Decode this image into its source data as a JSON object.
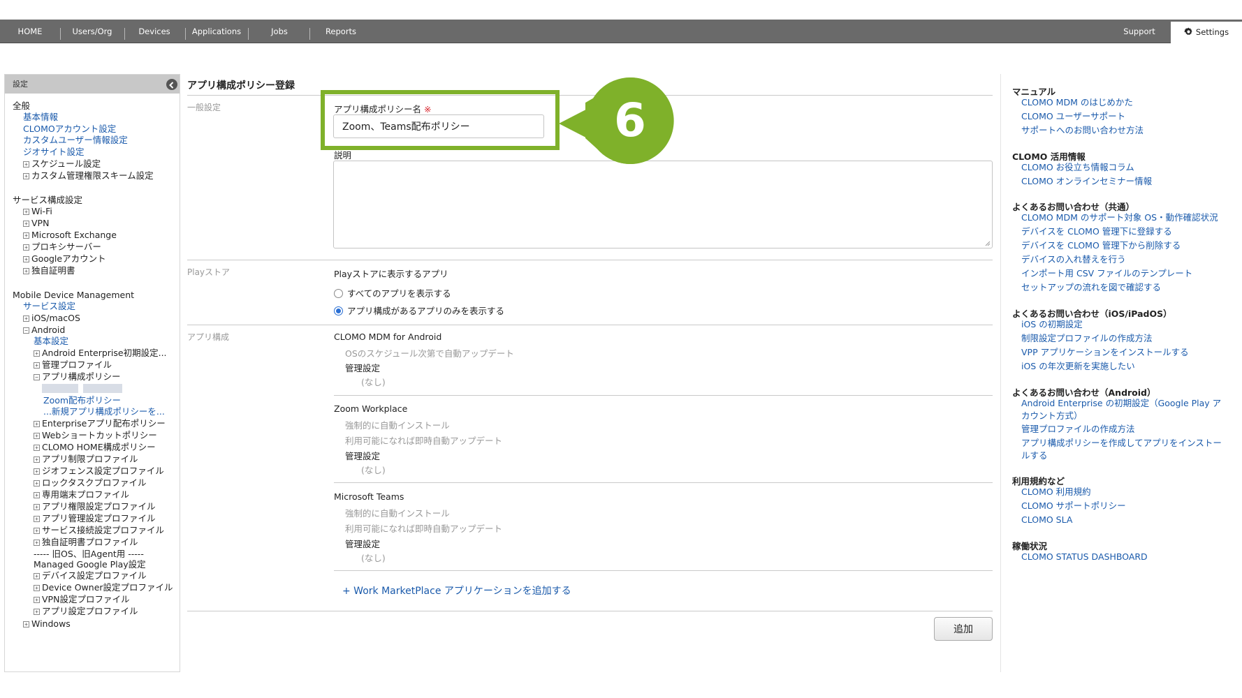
{
  "nav": {
    "items": [
      "HOME",
      "Users/Org",
      "Devices",
      "Applications",
      "Jobs",
      "Reports"
    ],
    "support": "Support",
    "settings": "Settings"
  },
  "sidebar": {
    "header": "設定",
    "general": "全般",
    "general_items": [
      "基本情報",
      "CLOMOアカウント設定",
      "カスタムユーザー情報設定",
      "ジオサイト設定"
    ],
    "general_expand": [
      "スケジュール設定",
      "カスタム管理権限スキーム設定"
    ],
    "service": "サービス構成設定",
    "service_items": [
      "Wi-Fi",
      "VPN",
      "Microsoft Exchange",
      "プロキシサーバー",
      "Googleアカウント",
      "独自証明書"
    ],
    "mdm": "Mobile Device Management",
    "mdm_service": "サービス設定",
    "ios": "iOS/macOS",
    "android": "Android",
    "android_basic": "基本設定",
    "android_items_1": [
      "Android Enterprise初期設定...",
      "管理プロファイル",
      "アプリ構成ポリシー"
    ],
    "policy_zoom": "Zoom配布ポリシー",
    "policy_new": "...新規アプリ構成ポリシーを...",
    "android_items_2": [
      "Enterpriseアプリ配布ポリシー",
      "Webショートカットポリシー",
      "CLOMO HOME構成ポリシー",
      "アプリ制限プロファイル",
      "ジオフェンス設定プロファイル",
      "ロックタスクプロファイル",
      "専用端末プロファイル",
      "アプリ権限設定プロファイル",
      "アプリ管理設定プロファイル",
      "サービス接続設定プロファイル",
      "独自証明書プロファイル"
    ],
    "legacy": "----- 旧OS、旧Agent用 -----",
    "managed_play": "Managed Google Play設定",
    "legacy_items": [
      "デバイス設定プロファイル",
      "Device Owner設定プロファイル",
      "VPN設定プロファイル",
      "アプリ設定プロファイル"
    ],
    "windows": "Windows"
  },
  "main": {
    "title": "アプリ構成ポリシー登録",
    "section_general": "一般設定",
    "policy_name_label": "アプリ構成ポリシー名",
    "required_mark": "※",
    "policy_name_value": "Zoom、Teams配布ポリシー",
    "description_label": "説明",
    "section_play": "Playストア",
    "play_label": "Playストアに表示するアプリ",
    "radio_all": "すべてのアプリを表示する",
    "radio_config": "アプリ構成があるアプリのみを表示する",
    "radio_selected": "config",
    "section_appconfig": "アプリ構成",
    "apps": [
      {
        "name": "CLOMO MDM for Android",
        "subs": [
          "OSのスケジュール次第で自動アップデート"
        ],
        "mgmt": "管理設定",
        "none": "(なし)"
      },
      {
        "name": "Zoom Workplace",
        "subs": [
          "強制的に自動インストール",
          "利用可能になれば即時自動アップデート"
        ],
        "mgmt": "管理設定",
        "none": "(なし)"
      },
      {
        "name": "Microsoft Teams",
        "subs": [
          "強制的に自動インストール",
          "利用可能になれば即時自動アップデート"
        ],
        "mgmt": "管理設定",
        "none": "(なし)"
      }
    ],
    "add_link": "+ Work MarketPlace アプリケーションを追加する",
    "add_button": "追加"
  },
  "annotation": {
    "number": "6",
    "color": "#7fb12a"
  },
  "rightbar": {
    "sections": [
      {
        "title": "マニュアル",
        "links": [
          "CLOMO MDM のはじめかた",
          "CLOMO ユーザーサポート",
          "サポートへのお問い合わせ方法"
        ]
      },
      {
        "title": "CLOMO 活用情報",
        "links": [
          "CLOMO お役立ち情報コラム",
          "CLOMO オンラインセミナー情報"
        ]
      },
      {
        "title": "よくあるお問い合わせ（共通）",
        "links": [
          "CLOMO MDM のサポート対象 OS・動作確認状況",
          "デバイスを CLOMO 管理下に登録する",
          "デバイスを CLOMO 管理下から削除する",
          "デバイスの入れ替えを行う",
          "インポート用 CSV ファイルのテンプレート",
          "セットアップの流れを図で確認する"
        ]
      },
      {
        "title": "よくあるお問い合わせ（iOS/iPadOS）",
        "links": [
          "iOS の初期設定",
          "制限設定プロファイルの作成方法",
          "VPP アプリケーションをインストールする",
          "iOS の年次更新を実施したい"
        ]
      },
      {
        "title": "よくあるお問い合わせ（Android）",
        "links": [
          "Android Enterprise の初期設定（Google Play ア",
          "カウント方式）",
          "管理プロファイルの作成方法",
          "アプリ構成ポリシーを作成してアプリをインストー",
          "ルする"
        ]
      },
      {
        "title": "利用規約など",
        "links": [
          "CLOMO 利用規約",
          "CLOMO サポートポリシー",
          "CLOMO SLA"
        ]
      },
      {
        "title": "稼働状況",
        "links": [
          "CLOMO STATUS DASHBOARD"
        ]
      }
    ]
  }
}
